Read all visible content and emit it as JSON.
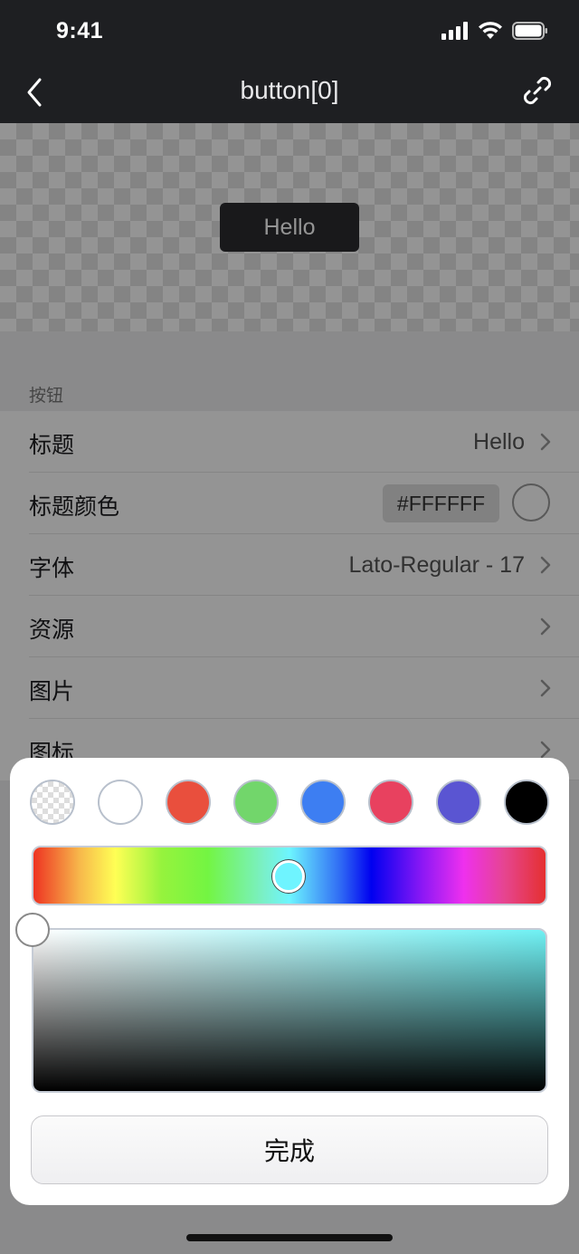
{
  "status": {
    "time": "9:41"
  },
  "nav": {
    "title": "button[0]",
    "back_icon": "chevron-left-icon",
    "link_icon": "link-icon"
  },
  "preview": {
    "button_label": "Hello"
  },
  "section": {
    "title": "按钮",
    "rows": [
      {
        "label": "标题",
        "value": "Hello"
      },
      {
        "label": "标题颜色",
        "hex": "#FFFFFF"
      },
      {
        "label": "字体",
        "value": "Lato-Regular - 17"
      },
      {
        "label": "资源",
        "value": ""
      },
      {
        "label": "图片",
        "value": ""
      },
      {
        "label": "图标",
        "value": ""
      }
    ]
  },
  "picker": {
    "presets": [
      "transparent",
      "#ffffff",
      "#e94f3d",
      "#72d66b",
      "#3d7ef2",
      "#e8415f",
      "#5a55d2",
      "#000000"
    ],
    "hue_color": "#6ff4ff",
    "done_label": "完成"
  }
}
